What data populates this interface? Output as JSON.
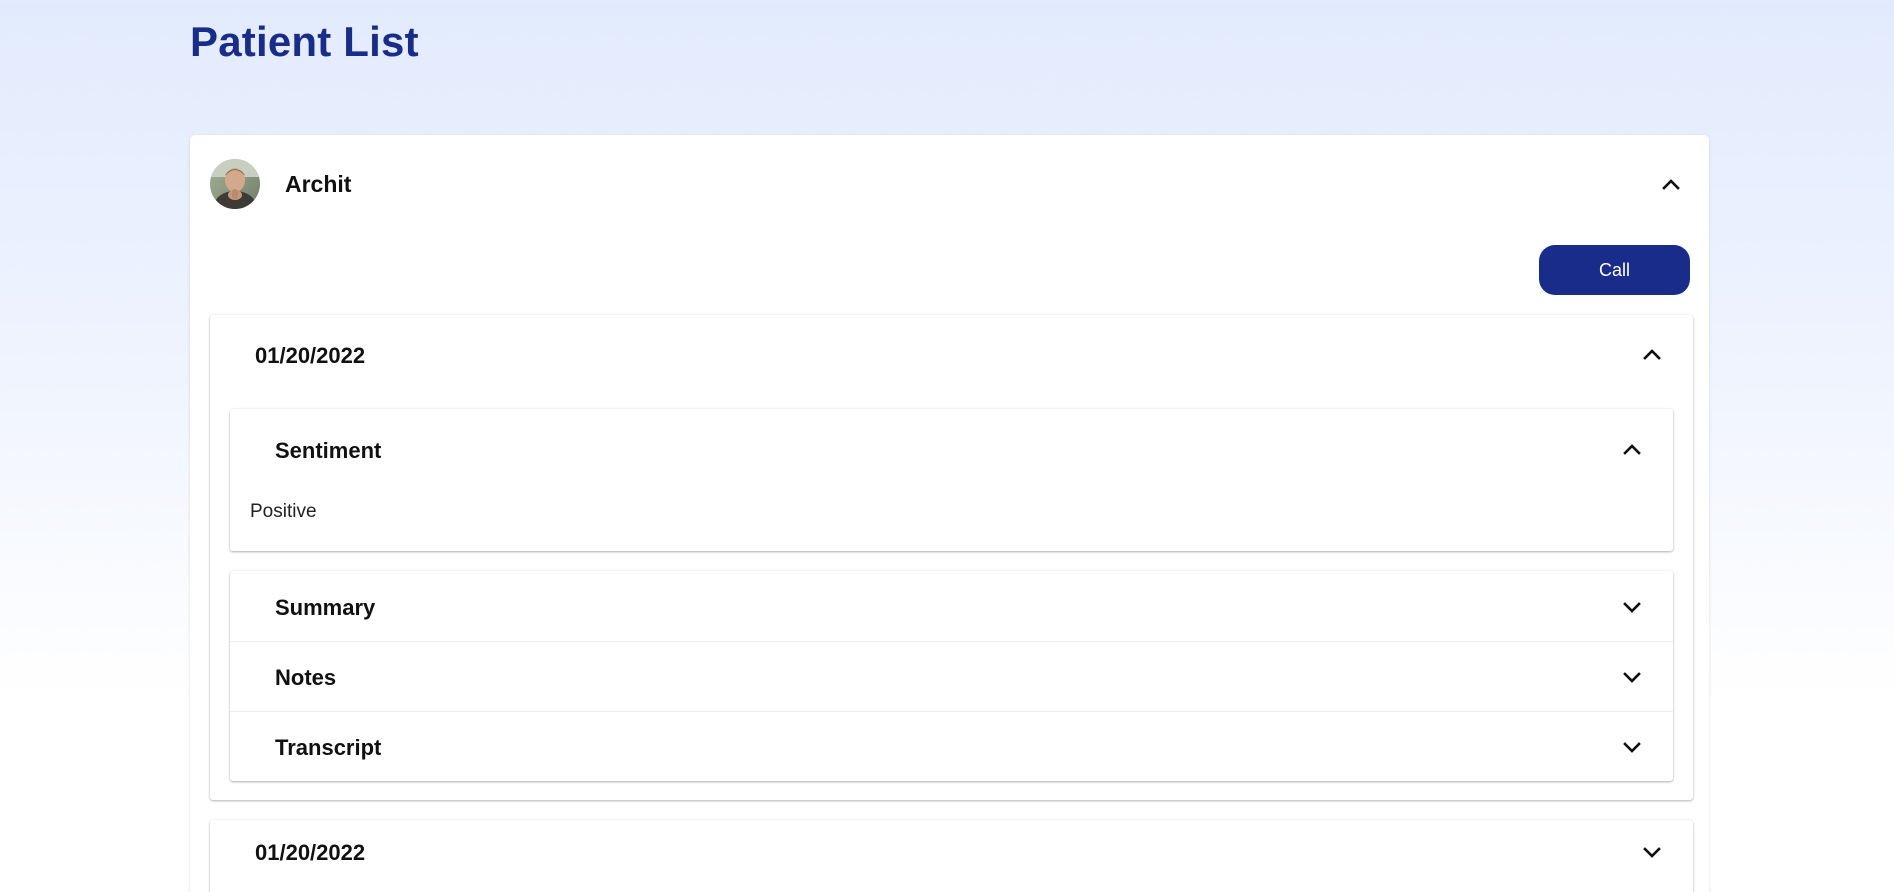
{
  "page": {
    "title": "Patient List"
  },
  "patient": {
    "name": "Archit",
    "expanded": true,
    "call_label": "Call"
  },
  "sessions": [
    {
      "date": "01/20/2022",
      "expanded": true,
      "sections": [
        {
          "title": "Sentiment",
          "expanded": true,
          "content": "Positive"
        },
        {
          "title": "Summary",
          "expanded": false
        },
        {
          "title": "Notes",
          "expanded": false
        },
        {
          "title": "Transcript",
          "expanded": false
        }
      ]
    },
    {
      "date": "01/20/2022",
      "expanded": false
    }
  ],
  "icons": {
    "expand": "chevron-down-icon",
    "collapse": "chevron-up-icon"
  },
  "colors": {
    "brand": "#1a2c8a",
    "background_top": "#e2ebfd",
    "background_bottom": "#ffffff",
    "card": "#ffffff"
  }
}
